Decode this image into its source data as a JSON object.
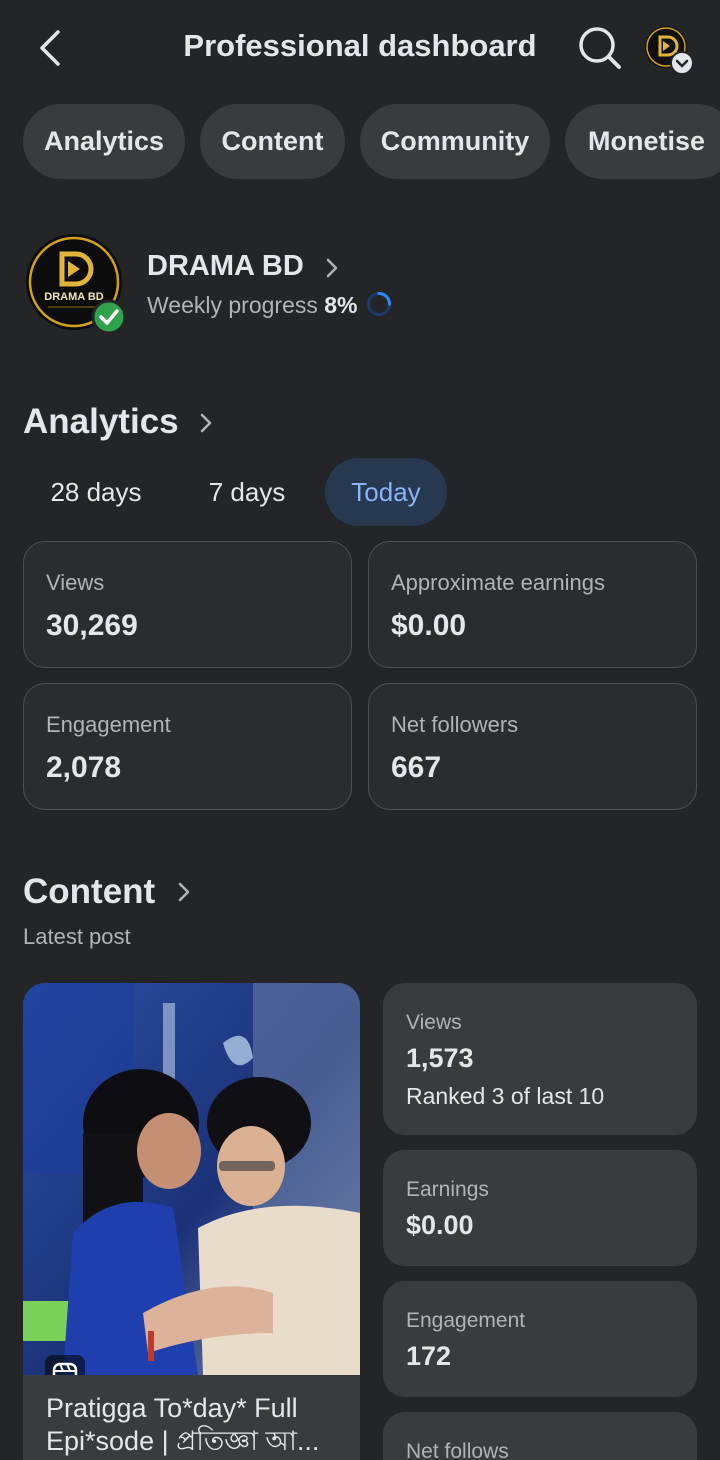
{
  "header": {
    "title": "Professional dashboard"
  },
  "tabs": [
    "Analytics",
    "Content",
    "Community",
    "Monetise"
  ],
  "page": {
    "name": "DRAMA BD",
    "logo_text": "DRAMA BD",
    "weekly_label": "Weekly progress",
    "weekly_value": "8%",
    "weekly_progress": 0.08
  },
  "analytics": {
    "title": "Analytics",
    "periods": [
      "28 days",
      "7 days",
      "Today"
    ],
    "active_period": "Today",
    "stats": [
      {
        "label": "Views",
        "value": "30,269"
      },
      {
        "label": "Approximate earnings",
        "value": "$0.00"
      },
      {
        "label": "Engagement",
        "value": "2,078"
      },
      {
        "label": "Net followers",
        "value": "667"
      }
    ]
  },
  "content": {
    "title": "Content",
    "subtitle": "Latest post",
    "post_caption": "Pratigga To*day* Full Epi*sode | প্রতিজ্ঞা আ...",
    "post_stats": [
      {
        "label": "Views",
        "value": "1,573",
        "sub": "Ranked 3 of last 10"
      },
      {
        "label": "Earnings",
        "value": "$0.00"
      },
      {
        "label": "Engagement",
        "value": "172"
      },
      {
        "label": "Net follows",
        "value": ""
      }
    ]
  },
  "colors": {
    "background": "#242526",
    "chip": "#3a3b3c",
    "accent": "#89b4f5",
    "verified": "#31a24c",
    "brand_gold": "#d4a017"
  }
}
